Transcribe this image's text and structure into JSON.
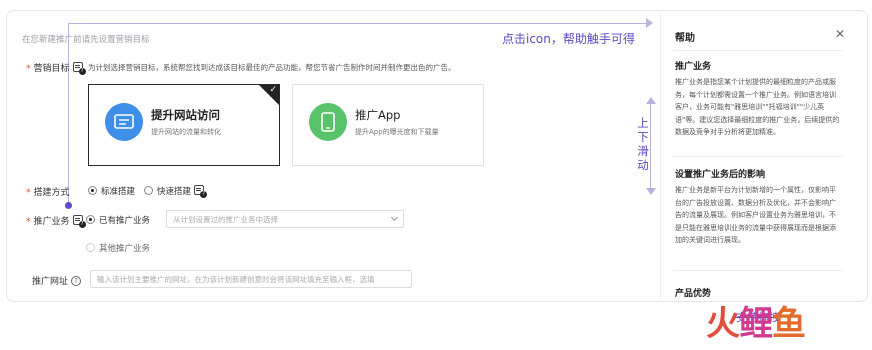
{
  "form": {
    "hint": "在您新建推广前请先设置营销目标",
    "goal_label": "营销目标",
    "goal_desc": "为计划选择营销目标，系统帮您找到达成该目标最佳的产品功能，帮您节省广告制作时间并制作更出色的广告。",
    "goals": [
      {
        "title": "提升网站访问",
        "subtitle": "提升网站的流量和转化",
        "selected": true
      },
      {
        "title": "推广App",
        "subtitle": "提升App的曝光度和下载量",
        "selected": false
      }
    ],
    "build_label": "搭建方式",
    "build_options": [
      "标准搭建",
      "快速搭建"
    ],
    "biz_label": "推广业务",
    "biz_options": [
      "已有推广业务",
      "其他推广业务"
    ],
    "biz_select_placeholder": "从计划设置过的推广业务中选择",
    "url_label": "推广网址",
    "url_placeholder": "输入该计划主要推广的网址，在为该计划新建创意时会将该网址填充至输入框，选填"
  },
  "annotations": {
    "click_hint": "点击icon，帮助触手可得",
    "scroll_hint": "上下滑动",
    "cursor_text": "支持拖拽"
  },
  "help_panel": {
    "title": "帮助",
    "sections": [
      {
        "title": "推广业务",
        "body": "推广业务是指您某个计划提供的最细粒度的产品或服务，每个计划都需设置一个推广业务。例如语言培训客户，业务可能有\"雅思培训\"\"托福培训\"\"少儿英语\"等。建议您选择最细粒度的推广业务，后续提供的数据及竞争对手分析将更加精准。"
      },
      {
        "title": "设置推广业务后的影响",
        "body": "推广业务是新平台为计划新增的一个属性，仅影响平台的广告投放设置、数据分析及优化，并不会影响广告的流量及展现。例如客户设置业务为雅思培训，不是只能在雅思培训业务的流量中获得展现而是根据添加的关键词进行展现。"
      },
      {
        "title": "产品优势",
        "body": ""
      }
    ]
  },
  "watermark": {
    "text": "火鲤鱼"
  },
  "colors": {
    "accent": "#5b4bc4",
    "blue_icon": "#3d8fe8",
    "green_icon": "#58c36b",
    "required": "#e0402c"
  }
}
